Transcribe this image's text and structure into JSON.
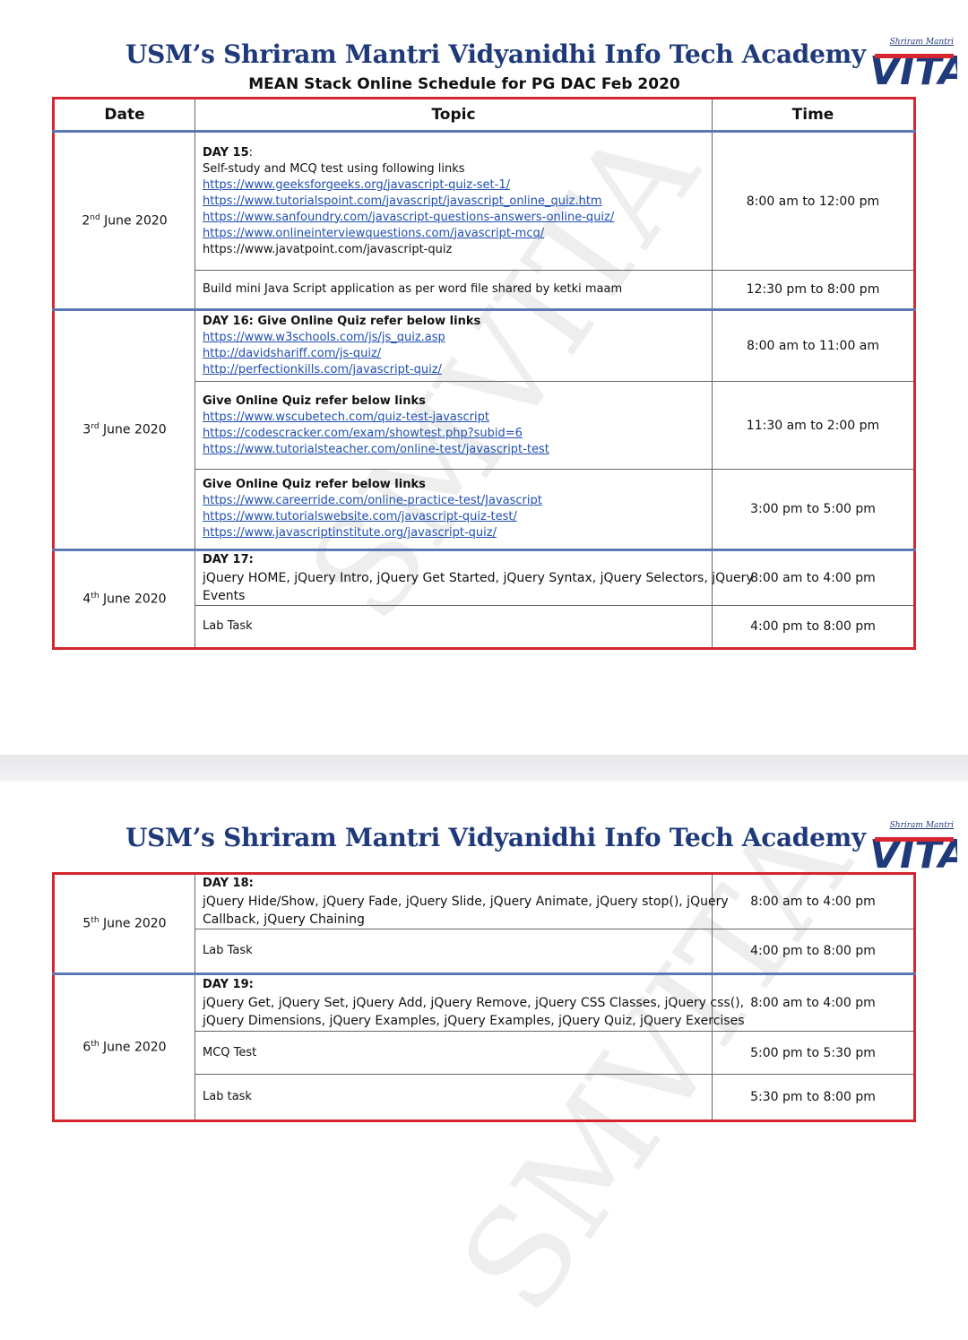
{
  "header": {
    "academy": "USM’s Shriram Mantri Vidyanidhi Info Tech Academy",
    "subtitle": "MEAN Stack Online Schedule for PG DAC Feb 2020",
    "logo_brand": "Shriram Mantri",
    "logo_text": "VITA",
    "watermark": "SMVITA"
  },
  "columns": {
    "date": "Date",
    "topic": "Topic",
    "time": "Time"
  },
  "page1": {
    "d1": {
      "date": "2",
      "sup": "nd",
      "rest": " June 2020",
      "r1": {
        "title": "DAY 15",
        "colon": ":",
        "desc": "Self-study and MCQ test using following links",
        "links": [
          "https://www.geeksforgeeks.org/javascript-quiz-set-1/",
          "https://www.tutorialspoint.com/javascript/javascript_online_quiz.htm",
          "https://www.sanfoundry.com/javascript-questions-answers-online-quiz/",
          "https://www.onlineinterviewquestions.com/javascript-mcq/"
        ],
        "plain": "https://www.javatpoint.com/javascript-quiz",
        "time": "8:00 am to 12:00 pm"
      },
      "r2": {
        "desc": "Build mini Java Script application as per word file shared by ketki maam",
        "time": "12:30 pm to 8:00 pm"
      }
    },
    "d2": {
      "date": "3",
      "sup": "rd",
      "rest": " June 2020",
      "r1": {
        "title": "DAY 16: Give Online Quiz refer below links",
        "links": [
          "https://www.w3schools.com/js/js_quiz.asp",
          "http://davidshariff.com/js-quiz/",
          "http://perfectionkills.com/javascript-quiz/"
        ],
        "time": "8:00 am to 11:00 am"
      },
      "r2": {
        "title": "Give Online Quiz refer below links",
        "links": [
          "https://www.wscubetech.com/quiz-test-javascript",
          "https://codescracker.com/exam/showtest.php?subid=6",
          "https://www.tutorialsteacher.com/online-test/javascript-test"
        ],
        "time": "11:30 am to 2:00 pm"
      },
      "r3": {
        "title": "Give Online Quiz refer below links",
        "links": [
          "https://www.careerride.com/online-practice-test/Javascript",
          "https://www.tutorialswebsite.com/javascript-quiz-test/",
          "https://www.javascriptinstitute.org/javascript-quiz/"
        ],
        "time": "3:00 pm to 5:00 pm"
      }
    },
    "d3": {
      "date": "4",
      "sup": "th",
      "rest": " June 2020",
      "r1": {
        "title": "DAY 17:",
        "line1": "jQuery HOME, jQuery Intro, jQuery Get Started, jQuery Syntax, jQuery Selectors, jQuery",
        "line2": "Events",
        "time": "8:00 am to 4:00 pm"
      },
      "r2": {
        "desc": "Lab Task",
        "time": "4:00 pm to 8:00 pm"
      }
    }
  },
  "page2": {
    "d1": {
      "date": "5",
      "sup": "th",
      "rest": " June 2020",
      "r1": {
        "title": "DAY 18:",
        "line1": "jQuery Hide/Show, jQuery Fade, jQuery Slide, jQuery Animate, jQuery stop(), jQuery",
        "line2": "Callback, jQuery Chaining",
        "time": "8:00 am to 4:00 pm"
      },
      "r2": {
        "desc": "Lab Task",
        "time": "4:00 pm to 8:00 pm"
      }
    },
    "d2": {
      "date": "6",
      "sup": "th",
      "rest": " June 2020",
      "r1": {
        "title": "DAY 19:",
        "line1": "jQuery Get, jQuery Set, jQuery Add, jQuery Remove, jQuery CSS Classes, jQuery css(),",
        "line2": "jQuery Dimensions, jQuery Examples, jQuery Examples, jQuery Quiz, jQuery Exercises",
        "time": "8:00 am to 4:00 pm"
      },
      "r2": {
        "desc": "MCQ Test",
        "time": "5:00 pm to 5:30 pm"
      },
      "r3": {
        "desc": "Lab task",
        "time": "5:30 pm to 8:00 pm"
      }
    }
  }
}
